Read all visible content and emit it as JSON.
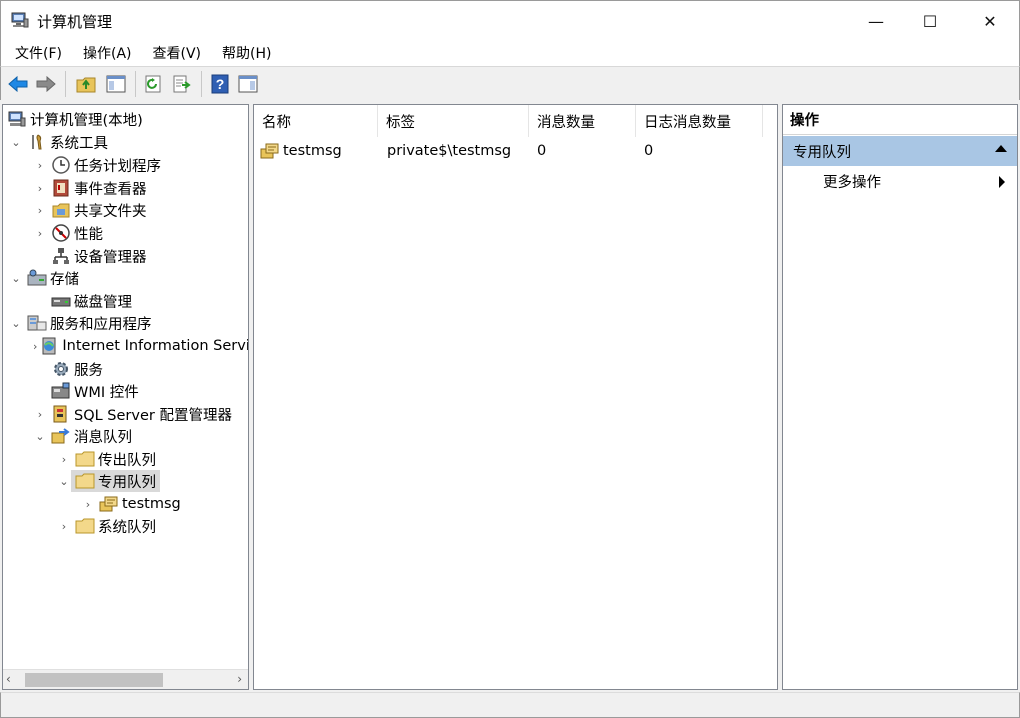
{
  "window": {
    "title": "计算机管理",
    "controls": {
      "minimize": "—",
      "maximize": "☐",
      "close": "✕"
    }
  },
  "menu": [
    {
      "label": "文件(F)"
    },
    {
      "label": "操作(A)"
    },
    {
      "label": "查看(V)"
    },
    {
      "label": "帮助(H)"
    }
  ],
  "toolbar": {
    "icons": [
      "back-arrow-icon",
      "forward-arrow-icon",
      "up-folder-icon",
      "show-hide-tree-icon",
      "refresh-icon",
      "export-list-icon",
      "help-icon",
      "show-hide-action-pane-icon"
    ],
    "help_label": "?"
  },
  "tree": {
    "root": "计算机管理(本地)",
    "items": [
      {
        "label": "系统工具",
        "expander": "⌄"
      },
      {
        "label": "任务计划程序",
        "expander": "›"
      },
      {
        "label": "事件查看器",
        "expander": "›"
      },
      {
        "label": "共享文件夹",
        "expander": "›"
      },
      {
        "label": "性能",
        "expander": "›"
      },
      {
        "label": "设备管理器",
        "expander": ""
      },
      {
        "label": "存储",
        "expander": "⌄"
      },
      {
        "label": "磁盘管理",
        "expander": ""
      },
      {
        "label": "服务和应用程序",
        "expander": "⌄"
      },
      {
        "label": "Internet Information Services",
        "expander": "›"
      },
      {
        "label": "服务",
        "expander": ""
      },
      {
        "label": "WMI 控件",
        "expander": ""
      },
      {
        "label": "SQL Server 配置管理器",
        "expander": "›"
      },
      {
        "label": "消息队列",
        "expander": "⌄"
      },
      {
        "label": "传出队列",
        "expander": "›"
      },
      {
        "label": "专用队列",
        "expander": "⌄"
      },
      {
        "label": "testmsg",
        "expander": "›"
      },
      {
        "label": "系统队列",
        "expander": "›"
      }
    ],
    "scroll": {
      "left": "‹",
      "right": "›"
    }
  },
  "list": {
    "columns": [
      "名称",
      "标签",
      "消息数量",
      "日志消息数量"
    ],
    "rows": [
      {
        "name": "testmsg",
        "label": "private$\\testmsg",
        "count": "0",
        "journal_count": "0"
      }
    ]
  },
  "actions": {
    "title": "操作",
    "section": "专用队列",
    "items": [
      {
        "label": "更多操作"
      }
    ]
  },
  "colors": {
    "selection_bg": "#d9d9d9",
    "action_section_bg": "#a9c6e4",
    "back_arrow": "#1e88e5"
  }
}
